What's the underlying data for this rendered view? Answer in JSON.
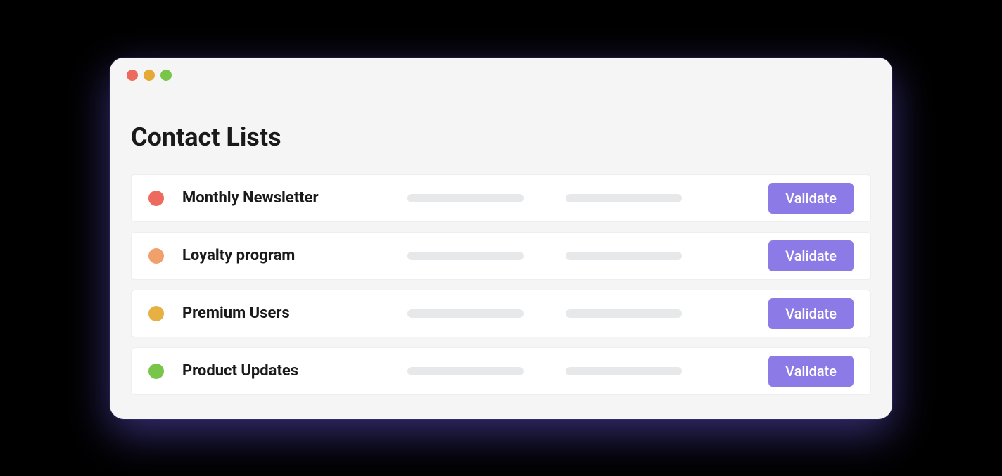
{
  "header": {
    "title": "Contact Lists"
  },
  "colors": {
    "accent": "#8c7ae6",
    "trafficRed": "#ed6a5e",
    "trafficYellow": "#e6a935",
    "trafficGreen": "#78c549"
  },
  "rows": [
    {
      "name": "Monthly Newsletter",
      "dotColor": "#ed6a5e",
      "button": "Validate"
    },
    {
      "name": "Loyalty program",
      "dotColor": "#f0a06b",
      "button": "Validate"
    },
    {
      "name": "Premium Users",
      "dotColor": "#e6b043",
      "button": "Validate"
    },
    {
      "name": "Product Updates",
      "dotColor": "#78c549",
      "button": "Validate"
    }
  ]
}
